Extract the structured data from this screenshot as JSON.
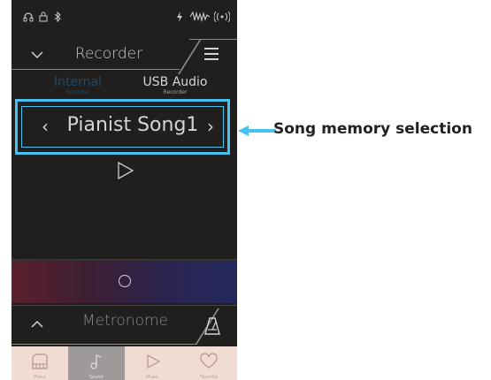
{
  "status_bar": {
    "icons": [
      "headphones-icon",
      "lock-icon",
      "bluetooth-icon",
      "power-icon",
      "wave-icon",
      "wireless-icon"
    ]
  },
  "recorder": {
    "title": "Recorder",
    "collapse_icon": "chevron-down-icon",
    "menu_icon": "list-icon",
    "sources": [
      {
        "label": "Internal",
        "sublabel": "Recorder",
        "active": true
      },
      {
        "label": "USB Audio",
        "sublabel": "Recorder",
        "active": false
      }
    ],
    "song": {
      "prev": "‹",
      "name": "Pianist Song1",
      "next": "›"
    },
    "play_icon": "play-icon",
    "record_icon": "record-icon"
  },
  "metronome": {
    "title": "Metronome",
    "expand_icon": "chevron-up-icon",
    "metronome_icon": "metronome-icon"
  },
  "bottom_nav": {
    "items": [
      {
        "label": "Piano",
        "icon": "piano-icon",
        "active": false
      },
      {
        "label": "Sound",
        "icon": "note-icon",
        "active": true
      },
      {
        "label": "Music",
        "icon": "play-icon",
        "active": false
      },
      {
        "label": "Favorite",
        "icon": "heart-icon",
        "active": false
      }
    ]
  },
  "callout": {
    "text": "Song memory selection",
    "color": "#46c1f0"
  },
  "colors": {
    "highlight": "#46c1f0",
    "background": "#211e1e",
    "nav_bg": "#f0dcd2",
    "nav_active": "#9d9a99"
  }
}
